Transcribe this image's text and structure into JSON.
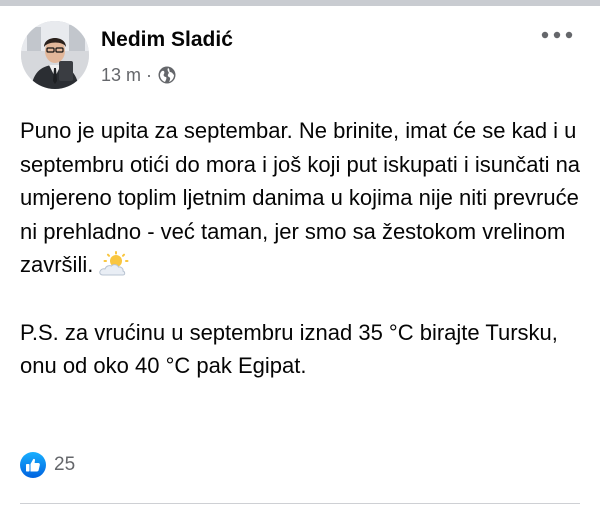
{
  "post": {
    "author_name": "Nedim Sladić",
    "time": "13 m",
    "separator": "·",
    "privacy_icon": "globe-icon",
    "more_icon": "more-horizontal-icon",
    "paragraphs": [
      "Puno je upita za septembar. Ne brinite, imat će se kad i u septembru otići do mora i još koji put iskupati i isunčati na umjereno toplim ljetnim danima u kojima nije niti prevruće ni prehladno - već taman, jer smo sa žestokom vrelinom završili.",
      "P.S. za vrućinu u septembru iznad 35 °C birajte Tursku, onu od oko 40 °C pak Egipat."
    ],
    "emoji": "sun-behind-cloud-icon"
  },
  "reactions": {
    "icon": "like-icon",
    "count": "25"
  },
  "colors": {
    "like_blue": "#1877f2",
    "secondary_text": "#65676b",
    "divider": "#ced0d4"
  }
}
